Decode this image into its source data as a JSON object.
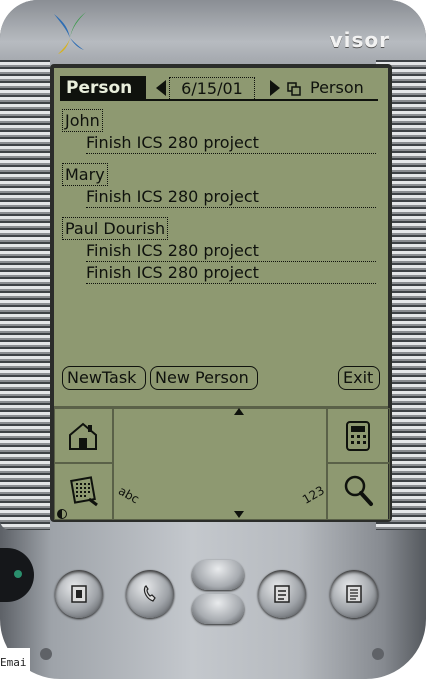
{
  "device": {
    "brand": "visor",
    "colors": {
      "lcd": "#8e9971",
      "ink": "#0f120d",
      "bezel": "#b6babf"
    }
  },
  "app": {
    "title": "Person",
    "date": "6/15/01",
    "view_selector": "Person",
    "groups": [
      {
        "person": "John",
        "tasks": [
          "Finish ICS 280 project"
        ]
      },
      {
        "person": "Mary",
        "tasks": [
          "Finish ICS 280 project"
        ]
      },
      {
        "person": "Paul Dourish",
        "tasks": [
          "Finish ICS 280 project",
          "Finish ICS 280 project"
        ]
      }
    ],
    "buttons": {
      "new_task": "NewTask",
      "new_person": "New Person",
      "exit": "Exit"
    }
  },
  "silkscreen": {
    "left_top_icon": "home-icon",
    "left_bottom_icon": "menu-icon",
    "right_top_icon": "calculator-icon",
    "right_bottom_icon": "find-icon",
    "abc_label": "abc",
    "num_label": "123"
  },
  "hardware_buttons": [
    "date-book-icon",
    "phone-icon",
    "scroll-up",
    "scroll-down",
    "todo-icon",
    "memo-icon"
  ],
  "edge_text": "Emai"
}
